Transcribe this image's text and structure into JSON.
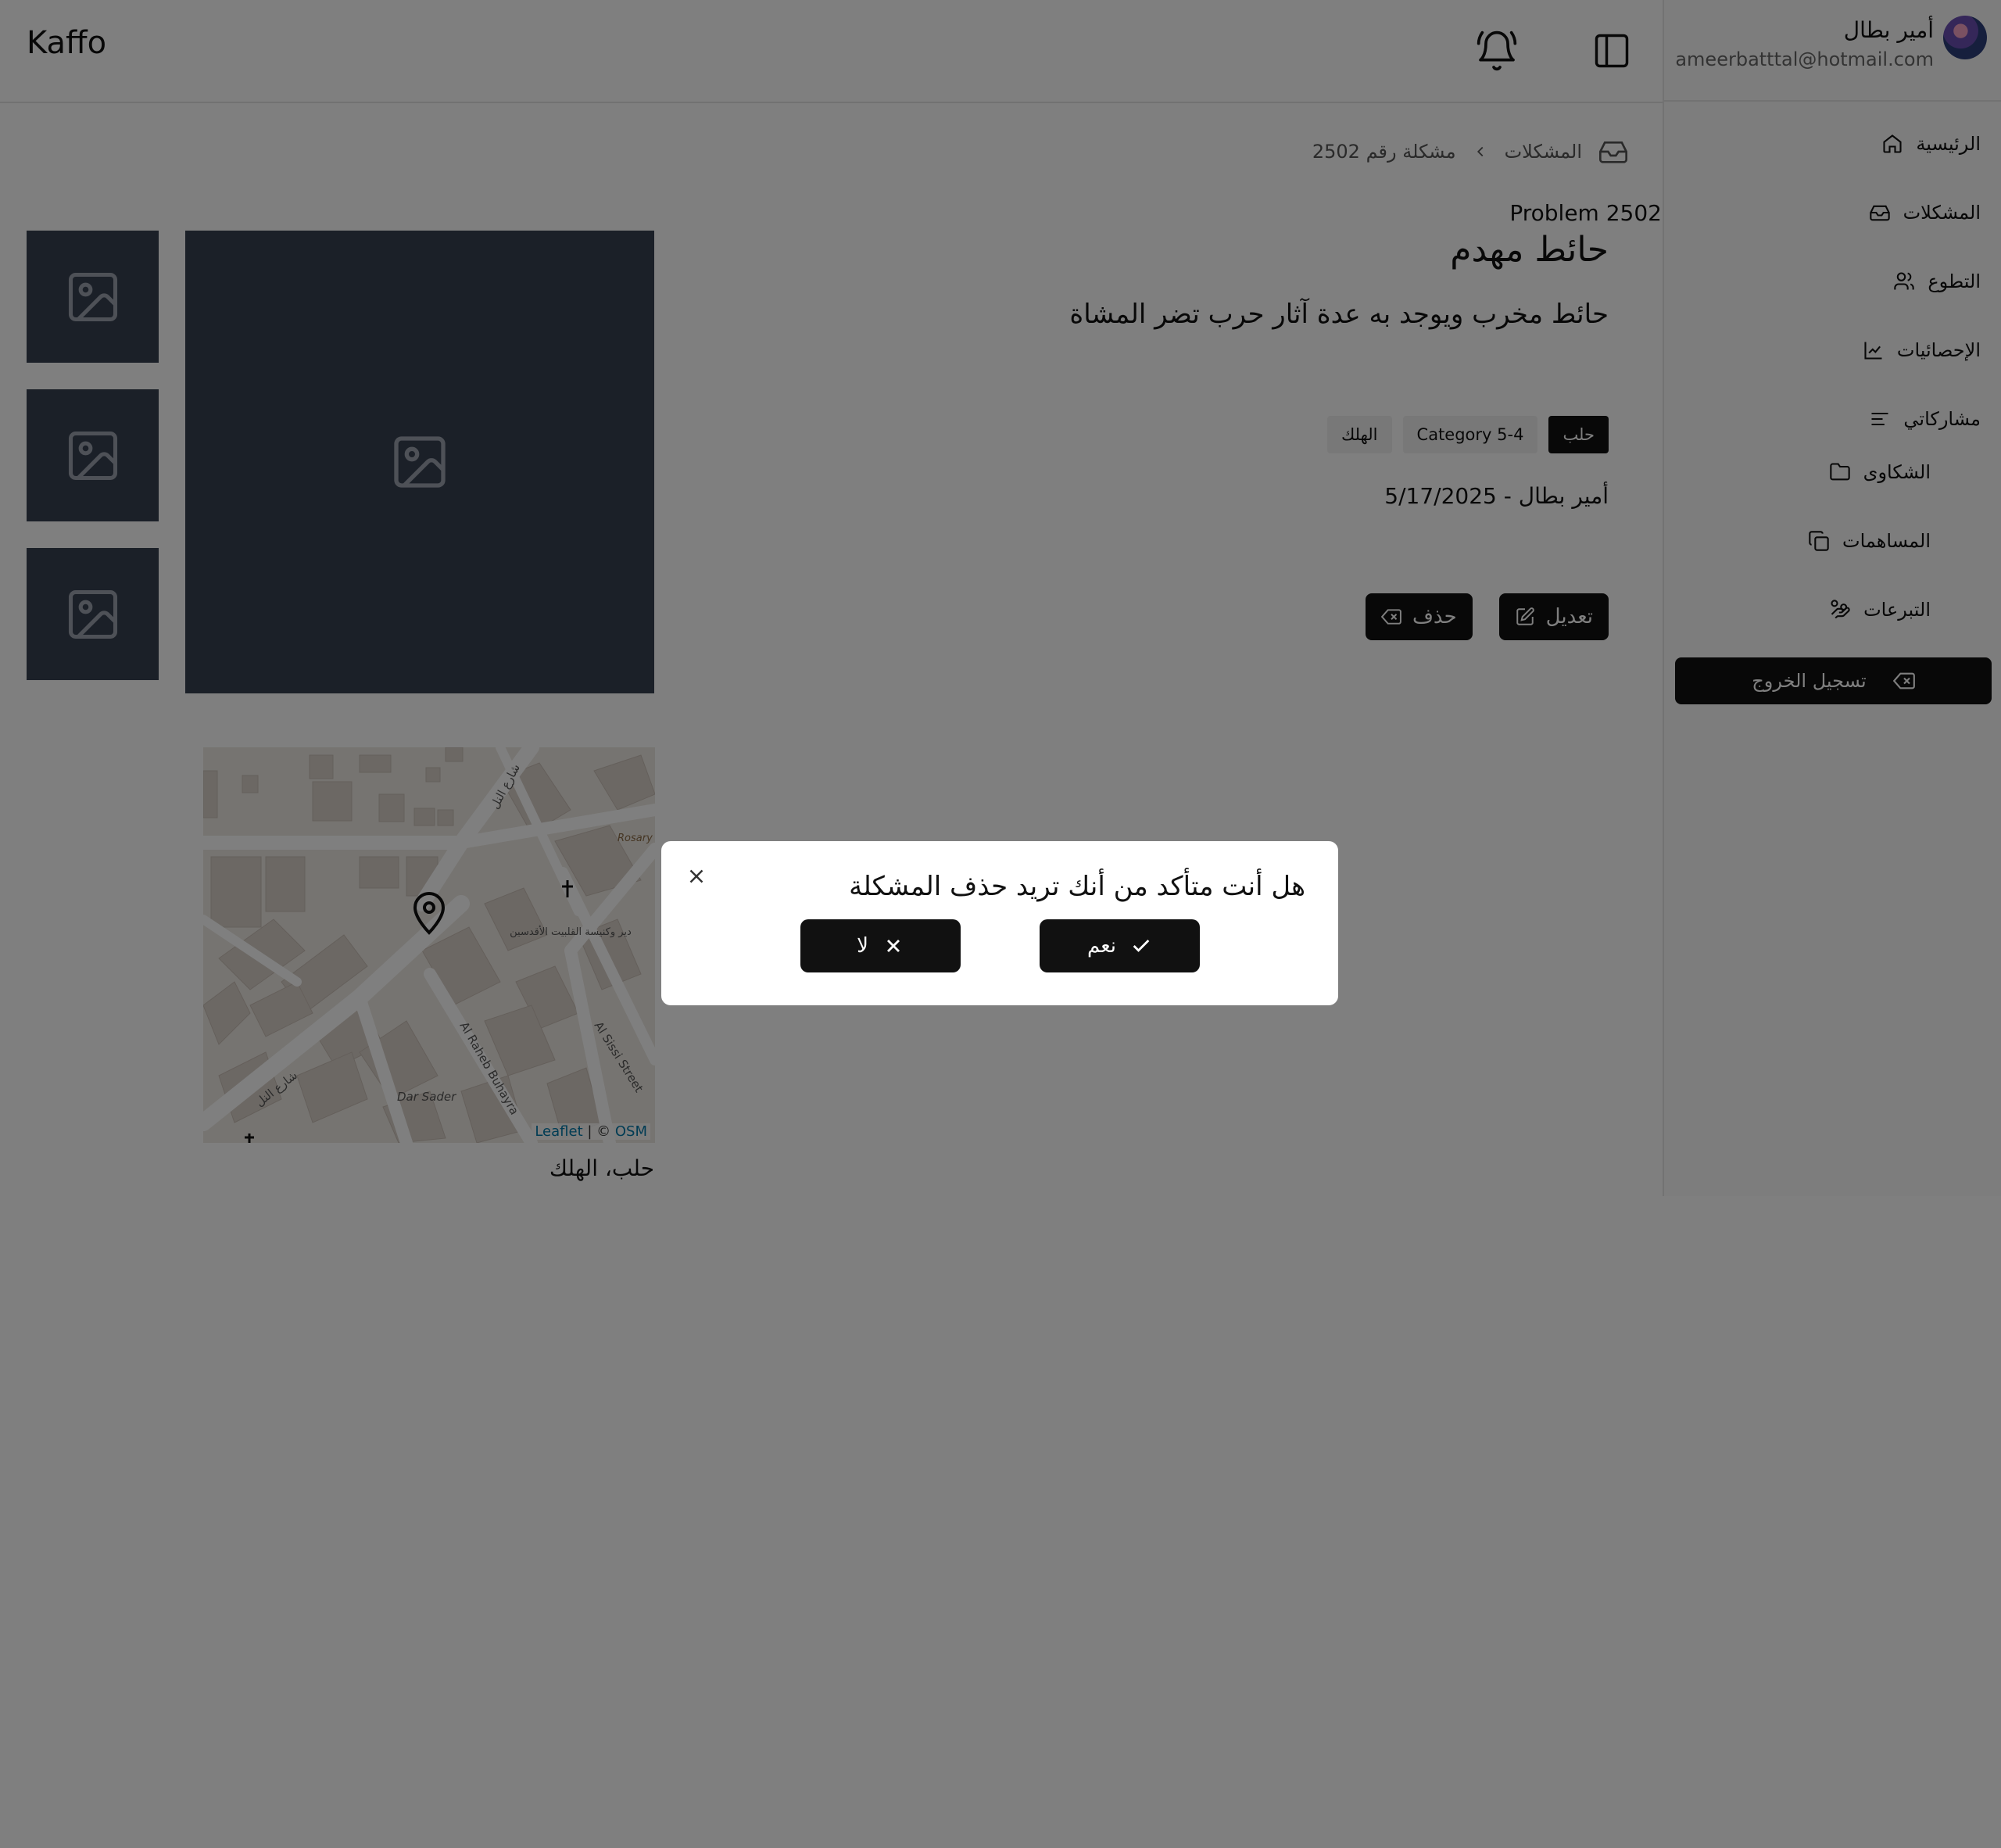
{
  "app": {
    "brand": "Kaffo"
  },
  "user": {
    "name": "أمير بطال",
    "email": "ameerbatttal@hotmail.com"
  },
  "sidebar": {
    "items": [
      {
        "label": "الرئيسية",
        "icon": "home-icon"
      },
      {
        "label": "المشكلات",
        "icon": "inbox-icon"
      },
      {
        "label": "التطوع",
        "icon": "users-icon"
      },
      {
        "label": "الإحصائيات",
        "icon": "chart-icon"
      },
      {
        "label": "مشاركاتي",
        "icon": "list-icon"
      }
    ],
    "subitems": [
      {
        "label": "الشكاوى",
        "icon": "folder-icon"
      },
      {
        "label": "المساهمات",
        "icon": "copy-icon"
      },
      {
        "label": "التبرعات",
        "icon": "hand-coins-icon"
      }
    ],
    "logout_label": "تسجيل الخروج"
  },
  "breadcrumb": {
    "section": "المشكلات",
    "current": "مشكلة رقم 2502"
  },
  "problem": {
    "id_label": "Problem 2502",
    "title": "حائط مهدم",
    "description": "حائط مخرب ويوجد به عدة آثار حرب تضر المشاة",
    "tags": [
      {
        "label": "حلب",
        "style": "dark"
      },
      {
        "label": "Category 5-4",
        "style": "light"
      },
      {
        "label": "الهلك",
        "style": "light"
      }
    ],
    "meta": "أمير بطال - 5/17/2025",
    "edit_label": "تعديل",
    "delete_label": "حذف",
    "location": "حلب، الهلك"
  },
  "map": {
    "attribution_leaflet": "Leaflet",
    "attribution_sep": " | © ",
    "attribution_osm": "OSM",
    "labels": {
      "street1": "شارع النل",
      "street2": "شارع النل",
      "church": "دير وكنيسة القلبيت الأقدسين",
      "school": "Rosary school aleppo",
      "street3": "Al Raheb Buhayra",
      "street4": "Al Sissi Street",
      "place": "Dar Sader"
    }
  },
  "dialog": {
    "message": "هل أنت متأكد من أنك تريد حذف المشكلة",
    "yes_label": "نعم",
    "no_label": "لا"
  },
  "colors": {
    "primary": "#111111",
    "image_placeholder": "#374151",
    "overlay": "rgba(0,0,0,0.5)"
  }
}
